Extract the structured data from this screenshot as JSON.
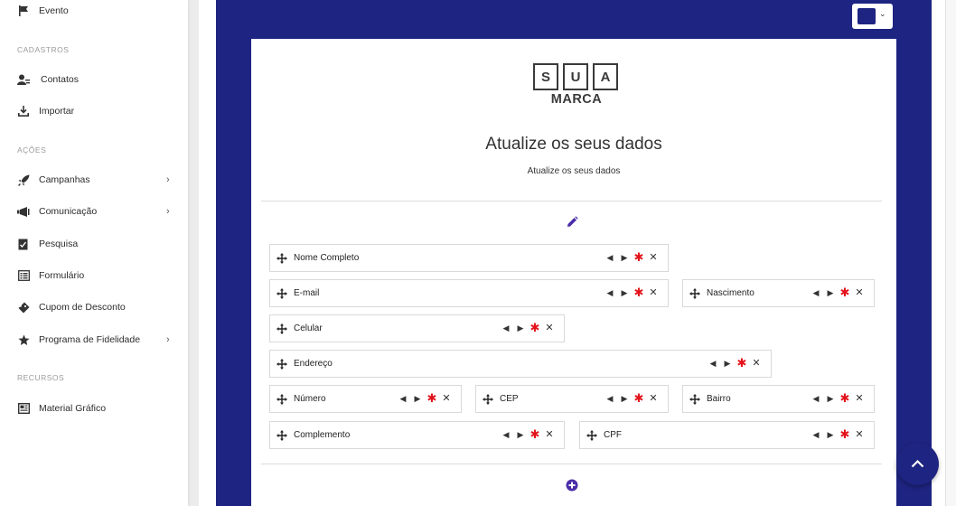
{
  "sidebar": {
    "items": [
      {
        "label": "Evento",
        "icon": "flag-icon"
      },
      {
        "label": "Contatos",
        "icon": "contacts-icon"
      },
      {
        "label": "Importar",
        "icon": "import-icon"
      },
      {
        "label": "Campanhas",
        "icon": "rocket-icon",
        "chevron": "›"
      },
      {
        "label": "Comunicação",
        "icon": "megaphone-icon",
        "chevron": "›"
      },
      {
        "label": "Pesquisa",
        "icon": "survey-icon"
      },
      {
        "label": "Formulário",
        "icon": "form-icon"
      },
      {
        "label": "Cupom de Desconto",
        "icon": "ticket-icon"
      },
      {
        "label": "Programa de Fidelidade",
        "icon": "star-icon",
        "chevron": "›"
      },
      {
        "label": "Material Gráfico",
        "icon": "newspaper-icon"
      }
    ],
    "sections": [
      "CADASTROS",
      "AÇÕES",
      "RECURSOS"
    ]
  },
  "colors": {
    "accent": "#1e2481",
    "required": "#e3131b"
  },
  "color_picker": {
    "caret": "⌄"
  },
  "logo": {
    "letters": [
      "S",
      "U",
      "A"
    ],
    "word": "MARCA"
  },
  "form": {
    "title": "Atualize os seus dados",
    "subtitle": "Atualize os seus dados",
    "fields": [
      {
        "label": "Nome Completo"
      },
      {
        "label": "E-mail"
      },
      {
        "label": "Nascimento"
      },
      {
        "label": "Celular"
      },
      {
        "label": "Endereço"
      },
      {
        "label": "Número"
      },
      {
        "label": "CEP"
      },
      {
        "label": "Bairro"
      },
      {
        "label": "Complemento"
      },
      {
        "label": "CPF"
      }
    ],
    "controls": {
      "left": "◀",
      "right": "▶",
      "required": "✱",
      "remove": "✕"
    }
  }
}
